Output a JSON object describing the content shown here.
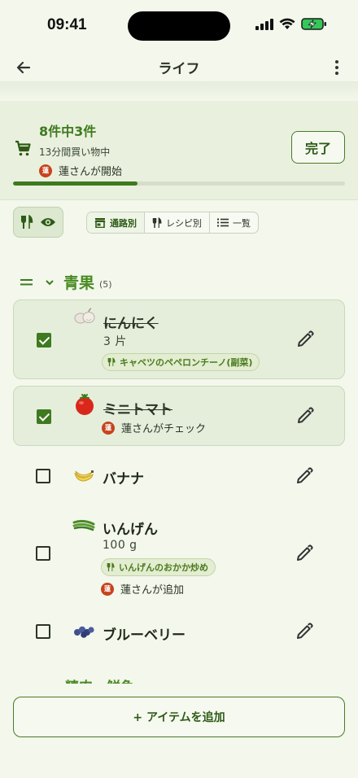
{
  "status": {
    "time": "09:41"
  },
  "app": {
    "title": "ライフ"
  },
  "progress": {
    "count_text": "8件中3件",
    "elapsed_text": "13分間買い物中",
    "started_text": "蓮さんが開始",
    "avatar_initial": "蓮",
    "done_label": "完了",
    "fraction": 0.375
  },
  "filters": {
    "segments": [
      {
        "label": "通路別",
        "icon": "store-icon",
        "active": true
      },
      {
        "label": "レシピ別",
        "icon": "utensils-icon",
        "active": false
      },
      {
        "label": "一覧",
        "icon": "list-icon",
        "active": false
      }
    ]
  },
  "category": {
    "name": "青果",
    "count": "(5)"
  },
  "items": [
    {
      "name": "にんにく",
      "checked": true,
      "qty": "3 片",
      "recipe": "キャベツのペペロンチーノ(副菜)",
      "icon": "garlic-icon"
    },
    {
      "name": "ミニトマト",
      "checked": true,
      "byline": "蓮さんがチェック",
      "icon": "tomato-icon"
    },
    {
      "name": "バナナ",
      "checked": false,
      "icon": "banana-icon"
    },
    {
      "name": "いんげん",
      "checked": false,
      "qty": "100 g",
      "recipe": "いんげんのおかか炒め",
      "byline": "蓮さんが追加",
      "icon": "green-beans-icon"
    },
    {
      "name": "ブルーベリー",
      "checked": false,
      "icon": "blueberry-icon"
    }
  ],
  "next_category": {
    "name": "精肉・鮮魚"
  },
  "add_button": {
    "label": "+ アイテムを追加"
  },
  "colors": {
    "accent": "#3e7a1f",
    "background": "#f3f7ec",
    "avatar": "#c6431e"
  }
}
